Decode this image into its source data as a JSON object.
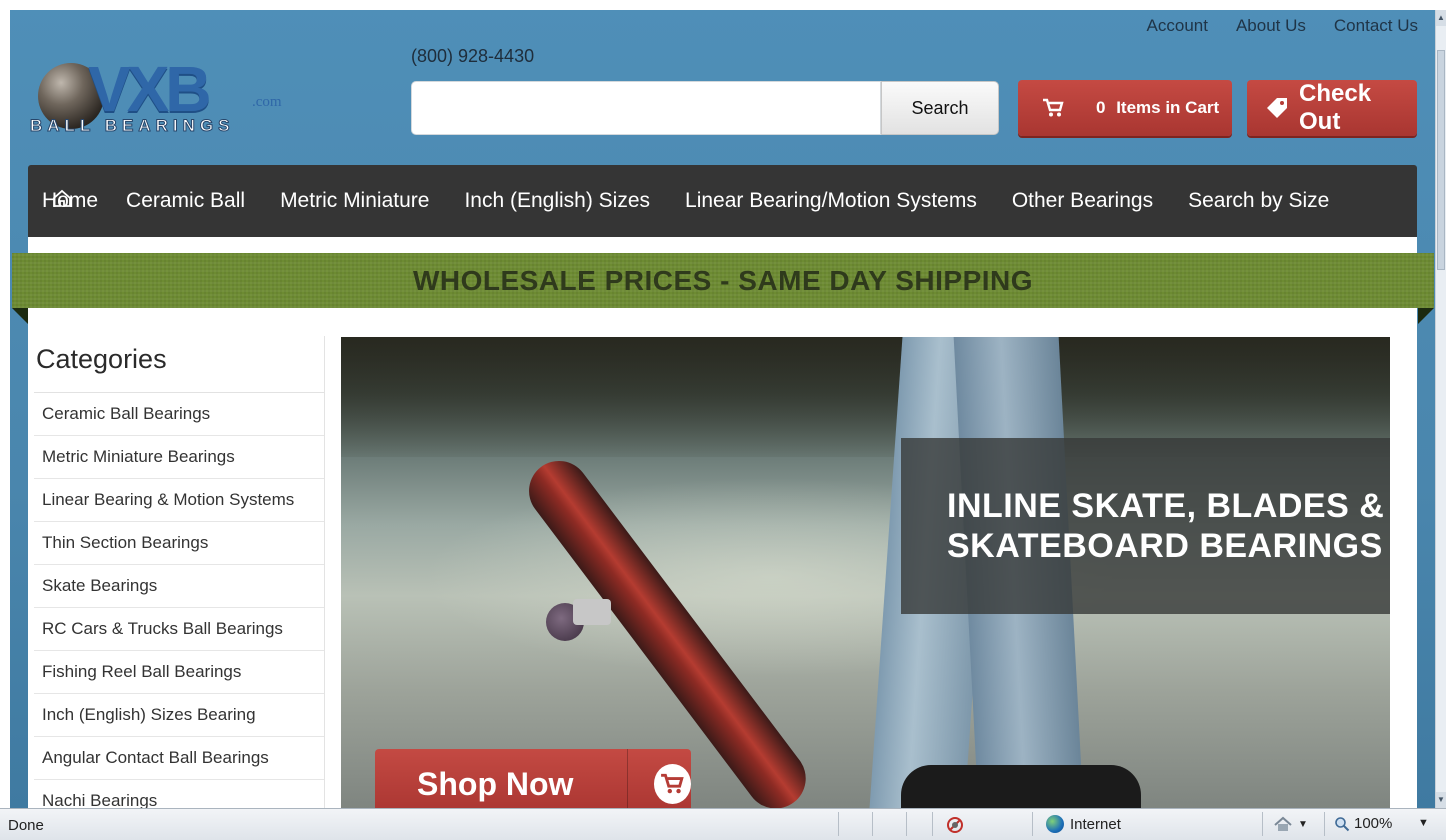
{
  "header": {
    "top_links": [
      "Account",
      "About Us",
      "Contact Us"
    ],
    "phone": "(800) 928-4430",
    "logo": {
      "brand": "VXB",
      "suffix": ".com",
      "tagline": "BALL BEARINGS"
    },
    "search": {
      "value": "",
      "placeholder": "",
      "button_label": "Search"
    },
    "cart": {
      "count": "0",
      "label": "Items in Cart"
    },
    "checkout_label": "Check Out"
  },
  "nav": {
    "home_label": "Home",
    "items": [
      "Ceramic Ball",
      "Metric Miniature",
      "Inch (English) Sizes",
      "Linear Bearing/Motion Systems",
      "Other Bearings",
      "Search by Size"
    ]
  },
  "promo": "WHOLESALE PRICES - SAME DAY SHIPPING",
  "sidebar": {
    "title": "Categories",
    "items": [
      "Ceramic Ball Bearings",
      "Metric Miniature Bearings",
      "Linear Bearing & Motion Systems",
      "Thin Section Bearings",
      "Skate Bearings",
      "RC Cars & Trucks Ball Bearings",
      "Fishing Reel Ball Bearings",
      "Inch (English) Sizes Bearing",
      "Angular Contact Ball Bearings",
      "Nachi Bearings"
    ]
  },
  "hero": {
    "headline_line1": "INLINE SKATE, BLADES &",
    "headline_line2": "SKATEBOARD BEARINGS",
    "cta_label": "Shop Now"
  },
  "statusbar": {
    "status": "Done",
    "zone": "Internet",
    "zoom": "100%"
  },
  "colors": {
    "page_blue": "#4b86ad",
    "nav_dark": "#353535",
    "promo_green": "#6d8b32",
    "button_red": "#b53c36"
  }
}
